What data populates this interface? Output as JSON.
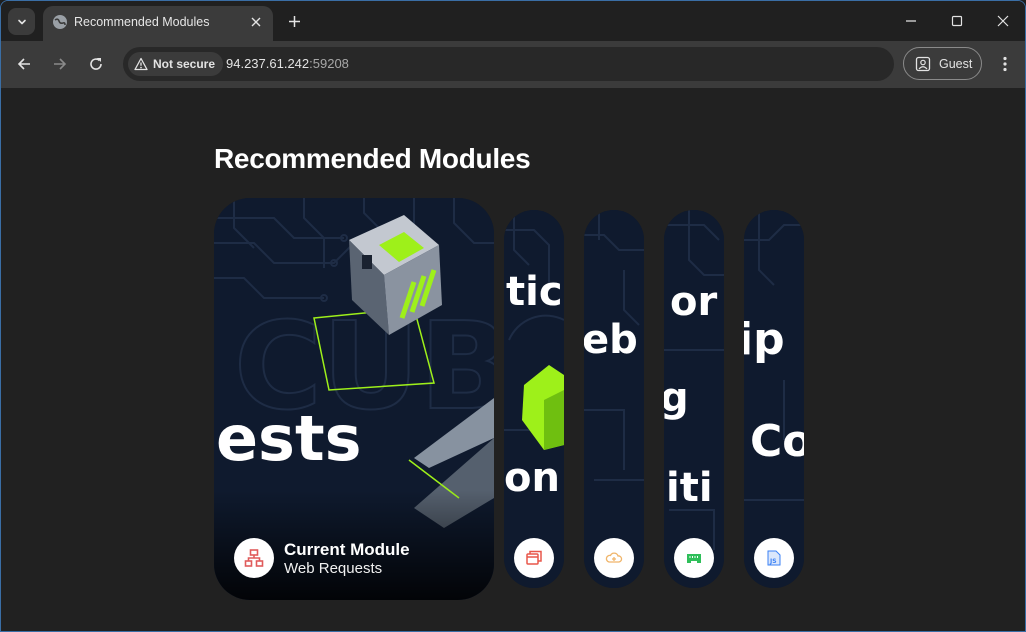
{
  "browser": {
    "tab_title": "Recommended Modules",
    "security_label": "Not secure",
    "url_host": "94.237.61.242",
    "url_port": ":59208",
    "profile_label": "Guest"
  },
  "page": {
    "heading": "Recommended Modules",
    "current_module": {
      "caption": "Current Module",
      "name": "Web Requests",
      "art_text": "ests",
      "icon": "network-icon",
      "icon_color": "#e05b5b"
    },
    "cards": [
      {
        "art_text_1": "tic",
        "art_text_2": "on",
        "icon": "windows-icon",
        "icon_color": "#e8574a"
      },
      {
        "art_text_1": "eb",
        "icon": "web-cloud-icon",
        "icon_color": "#f0b56a"
      },
      {
        "art_text_1": "or",
        "art_text_2": "g",
        "art_text_3": "iti",
        "icon": "ethernet-icon",
        "icon_color": "#2fbf5a"
      },
      {
        "art_text_1": "ip",
        "art_text_2": "Co",
        "icon": "javascript-icon",
        "icon_color": "#3b82f6"
      }
    ]
  },
  "colors": {
    "card_bg": "#0f1a2e",
    "accent_green": "#9ef01a",
    "page_bg": "#212121",
    "toolbar_bg": "#3b3b3b"
  }
}
